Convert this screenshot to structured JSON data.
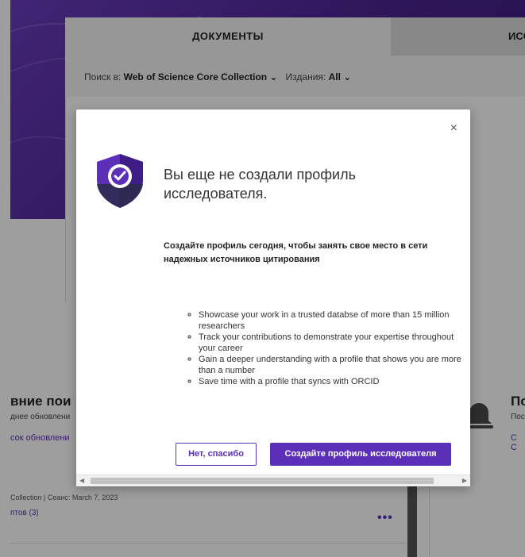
{
  "search": {
    "tabs": {
      "documents": "ДОКУМЕНТЫ",
      "researchers": "ИСС"
    },
    "search_in_label": "Поиск в:",
    "search_in_value": "Web of Science Core Collection",
    "editions_label": "Издания:",
    "editions_value": "All"
  },
  "background": {
    "left": {
      "heading": "вние пои",
      "sub": "днее обновлени",
      "link": "сок обновлени",
      "meta": "Collection | Сеанс: March 7, 2023",
      "count": "птов (3)",
      "more": "•••"
    },
    "right": {
      "heading": "По",
      "sub": "Пос",
      "link": "C C"
    }
  },
  "modal": {
    "close": "×",
    "title": "Вы еще не создали профиль исследователя.",
    "subtitle": "Создайте профиль сегодня, чтобы занять свое место в сети надежных источников цитирования",
    "benefits": [
      "Showcase your work in a trusted databse of more than 15 million researchers",
      "Track your contributions to demonstrate your expertise throughout your career",
      "Gain a deeper understanding with a profile that shows you are more than a number",
      "Save time with a profile that syncs with ORCID"
    ],
    "no_thanks": "Нет, спасибо",
    "create": "Создайте профиль исследователя"
  },
  "colors": {
    "accent": "#5b2fb8",
    "hero": "#4a2490",
    "overlay": "rgba(0,0,0,0.38)"
  },
  "icons": {
    "close": "close-icon",
    "shield": "shield-check-icon",
    "chevron": "chevron-down-icon",
    "bell": "bell-icon"
  }
}
